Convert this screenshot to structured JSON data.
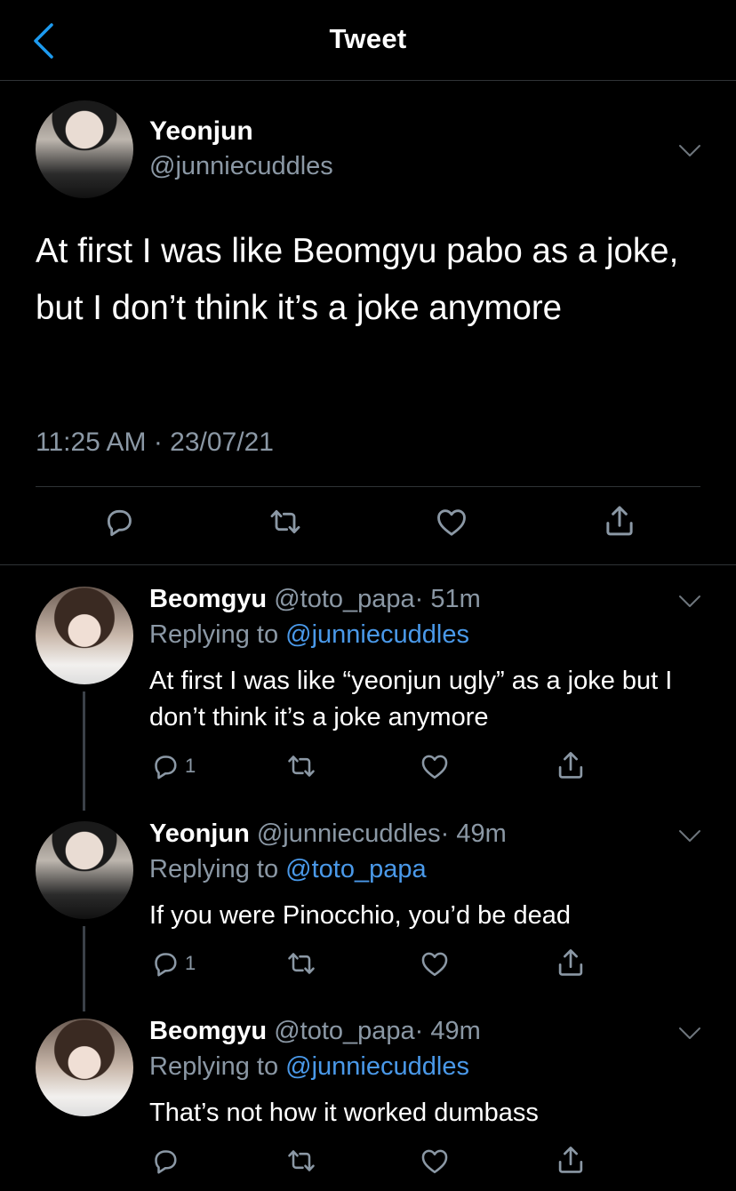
{
  "header": {
    "title": "Tweet",
    "back_icon": "chevron-left-icon",
    "accent": "#1d9bf0"
  },
  "main_tweet": {
    "name": "Yeonjun",
    "handle": "@junniecuddles",
    "text": "At first I was like Beomgyu pabo as a joke, but I don’t think it’s a joke anymore",
    "timestamp": "11:25 AM · 23/07/21",
    "actions": [
      "reply-icon",
      "retweet-icon",
      "like-icon",
      "share-icon"
    ]
  },
  "replies": [
    {
      "name": "Beomgyu",
      "handle": "@toto_papa",
      "time": "· 51m",
      "replying_prefix": "Replying to",
      "replying_to": "@junniecuddles",
      "text": "At first I was like “yeonjun ugly” as a joke but I don’t think it’s a joke anymore",
      "reply_count": "1"
    },
    {
      "name": "Yeonjun",
      "handle": "@junniecuddles",
      "time": "· 49m",
      "replying_prefix": "Replying to",
      "replying_to": "@toto_papa",
      "text": "If you were Pinocchio, you’d be dead",
      "reply_count": "1"
    },
    {
      "name": "Beomgyu",
      "handle": "@toto_papa",
      "time": "· 49m",
      "replying_prefix": "Replying to",
      "replying_to": "@junniecuddles",
      "text": "That’s not how it worked dumbass",
      "reply_count": ""
    }
  ]
}
